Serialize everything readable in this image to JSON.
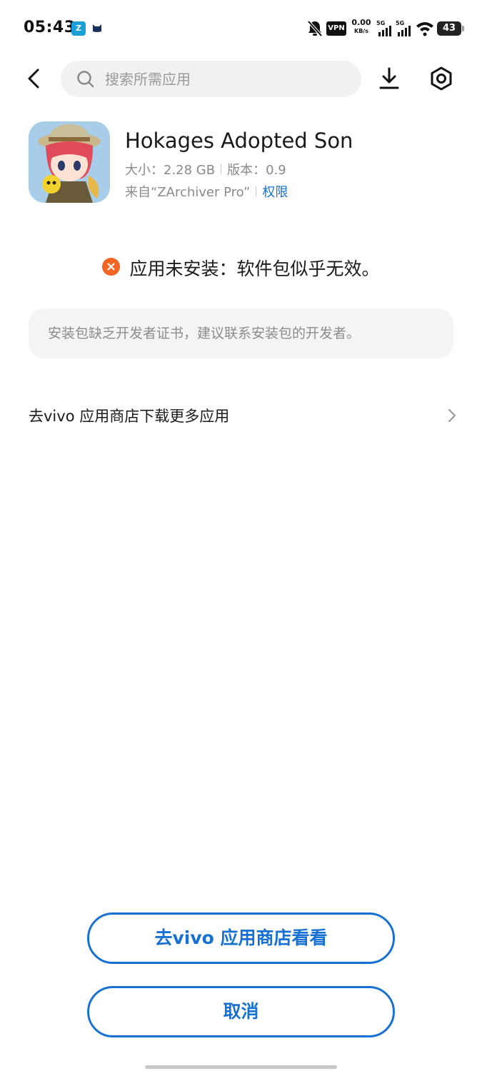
{
  "status_bar": {
    "time": "05:43",
    "notif_app_1": "Z",
    "vpn": "VPN",
    "net_speed_value": "0.00",
    "net_speed_unit": "KB/s",
    "signal_1_label": "5G",
    "signal_2_label": "5G",
    "battery": "43"
  },
  "toolbar": {
    "search_placeholder": "搜索所需应用",
    "icons": [
      "back-arrow-icon",
      "search-icon",
      "download-icon",
      "settings-icon"
    ]
  },
  "app": {
    "name": "Hokages Adopted Son",
    "size": "大小：2.28 GB",
    "version": "版本：0.9",
    "source": "来自“ZArchiver Pro”",
    "permissions_link": "权限"
  },
  "error": {
    "message": "应用未安装：软件包似乎无效。",
    "detail": "安装包缺乏开发者证书，建议联系安装包的开发者。"
  },
  "store_link": {
    "label": "去vivo 应用商店下载更多应用"
  },
  "buttons": {
    "store": "去vivo 应用商店看看",
    "cancel": "取消"
  },
  "colors": {
    "accent": "#1771d4",
    "error": "#f26522",
    "search_bg": "#f1f1f1"
  }
}
